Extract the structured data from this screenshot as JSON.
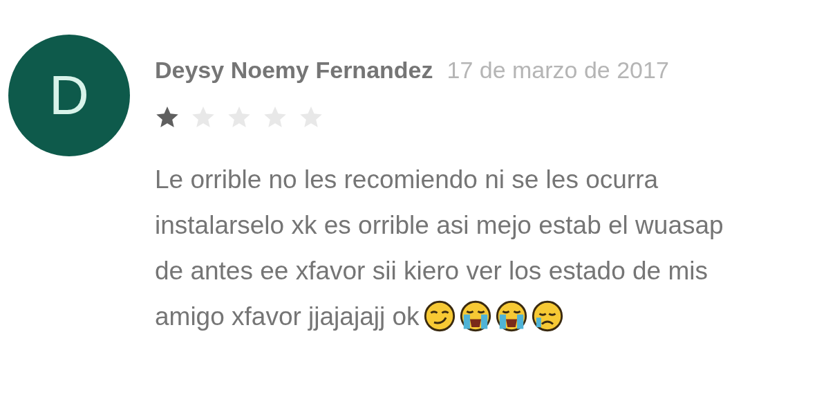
{
  "review": {
    "avatar_letter": "D",
    "author": "Deysy Noemy Fernandez",
    "date": "17 de marzo de 2017",
    "stars": 1,
    "text": "Le orrible no les recomiendo ni se les ocurra instalarselo xk es orrible asi mejo estab el wuasap de antes ee xfavor sii kiero ver los estado de mis amigo xfavor jjajajajj ok",
    "emojis": [
      {
        "kind": "smirk"
      },
      {
        "kind": "sobbing"
      },
      {
        "kind": "sobbing"
      },
      {
        "kind": "sad-tear"
      }
    ]
  }
}
